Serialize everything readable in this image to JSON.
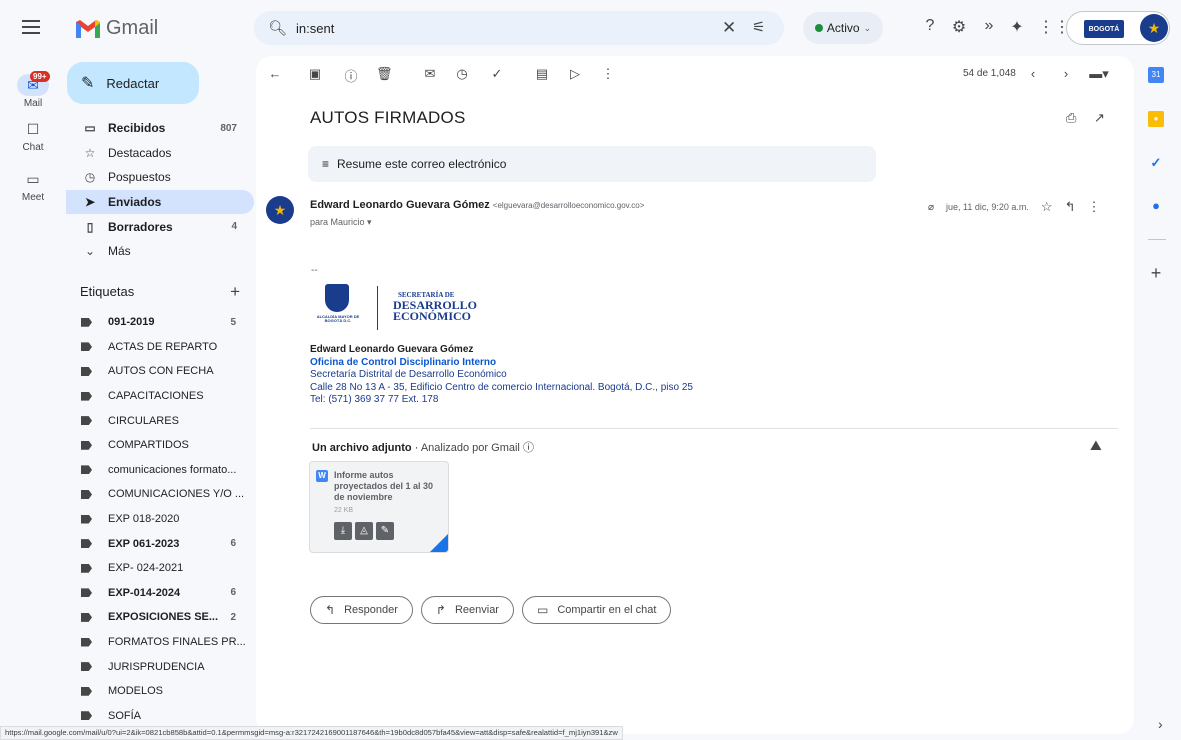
{
  "app": {
    "name": "Gmail"
  },
  "search": {
    "query": "in:sent"
  },
  "status": {
    "label": "Activo"
  },
  "rail": {
    "mail_label": "Mail",
    "mail_badge": "99+",
    "chat_label": "Chat",
    "meet_label": "Meet"
  },
  "compose": {
    "label": "Redactar"
  },
  "nav": [
    {
      "label": "Recibidos",
      "count": "807",
      "icon": "inbox-icon",
      "bold": true
    },
    {
      "label": "Destacados",
      "count": "",
      "icon": "star-icon",
      "bold": false
    },
    {
      "label": "Pospuestos",
      "count": "",
      "icon": "clock-icon",
      "bold": false
    },
    {
      "label": "Enviados",
      "count": "",
      "icon": "send-icon",
      "bold": true
    },
    {
      "label": "Borradores",
      "count": "4",
      "icon": "draft-icon",
      "bold": true
    },
    {
      "label": "Más",
      "count": "",
      "icon": "chevron-down-icon",
      "bold": false
    }
  ],
  "labels_heading": "Etiquetas",
  "labels": [
    {
      "label": "091-2019",
      "count": "5",
      "bold": true
    },
    {
      "label": "ACTAS DE REPARTO",
      "count": "",
      "bold": false
    },
    {
      "label": "AUTOS CON FECHA",
      "count": "",
      "bold": false
    },
    {
      "label": "CAPACITACIONES",
      "count": "",
      "bold": false
    },
    {
      "label": "CIRCULARES",
      "count": "",
      "bold": false
    },
    {
      "label": "COMPARTIDOS",
      "count": "",
      "bold": false
    },
    {
      "label": "comunicaciones formato...",
      "count": "",
      "bold": false
    },
    {
      "label": "COMUNICACIONES Y/O ...",
      "count": "",
      "bold": false
    },
    {
      "label": "EXP 018-2020",
      "count": "",
      "bold": false
    },
    {
      "label": "EXP 061-2023",
      "count": "6",
      "bold": true
    },
    {
      "label": "EXP- 024-2021",
      "count": "",
      "bold": false
    },
    {
      "label": "EXP-014-2024",
      "count": "6",
      "bold": true
    },
    {
      "label": "EXPOSICIONES SE...",
      "count": "2",
      "bold": true
    },
    {
      "label": "FORMATOS FINALES PR...",
      "count": "",
      "bold": false
    },
    {
      "label": "JURISPRUDENCIA",
      "count": "",
      "bold": false
    },
    {
      "label": "MODELOS",
      "count": "",
      "bold": false
    },
    {
      "label": "SOFÍA",
      "count": "",
      "bold": false
    }
  ],
  "toolbar": {
    "pager": "54 de 1,048"
  },
  "message": {
    "subject": "AUTOS FIRMADOS",
    "summary_label": "Resume este correo electrónico",
    "sender_name": "Edward Leonardo Guevara Gómez",
    "sender_email": "<elguevara@desarrolloeconomico.gov.co>",
    "to": "para Mauricio",
    "date": "jue, 11 dic, 9:20 a.m."
  },
  "signature": {
    "dash": "--",
    "crest_text": "ALCALDÍA MAYOR DE BOGOTÁ D.C.",
    "sec": "SECRETARÍA DE",
    "des1": "DESARROLLO",
    "des2": "ECONÓMICO",
    "name": "Edward Leonardo Guevara Gómez",
    "office": "Oficina de Control Disciplinario Interno",
    "line1": "Secretaría Distrital de Desarrollo Económico",
    "line2": "Calle 28 No 13 A - 35, Edificio Centro de comercio Internacional. Bogotá, D.C., piso 25",
    "line3": "Tel: (571) 369 37 77 Ext. 178"
  },
  "attachments": {
    "heading": "Un archivo adjunto",
    "scanned": "Analizado por Gmail",
    "file_type": "W",
    "file_name": "Informe autos proyectados del 1 al 30 de noviembre",
    "file_size": "22 KB"
  },
  "actions": {
    "reply": "Responder",
    "forward": "Reenviar",
    "share": "Compartir en el chat"
  },
  "account": {
    "brand": "BOGOTÁ"
  },
  "url": "https://mail.google.com/mail/u/0?ui=2&ik=0821cb858b&attid=0.1&permmsgid=msg-a:r3217242169001187646&th=19b0dc8d057bfa45&view=att&disp=safe&realattid=f_mj1iyn391&zw",
  "colors": {
    "accent": "#0b57d0",
    "compose": "#c2e7ff",
    "active_nav": "#d3e3fd",
    "background": "#f6f8fc"
  }
}
